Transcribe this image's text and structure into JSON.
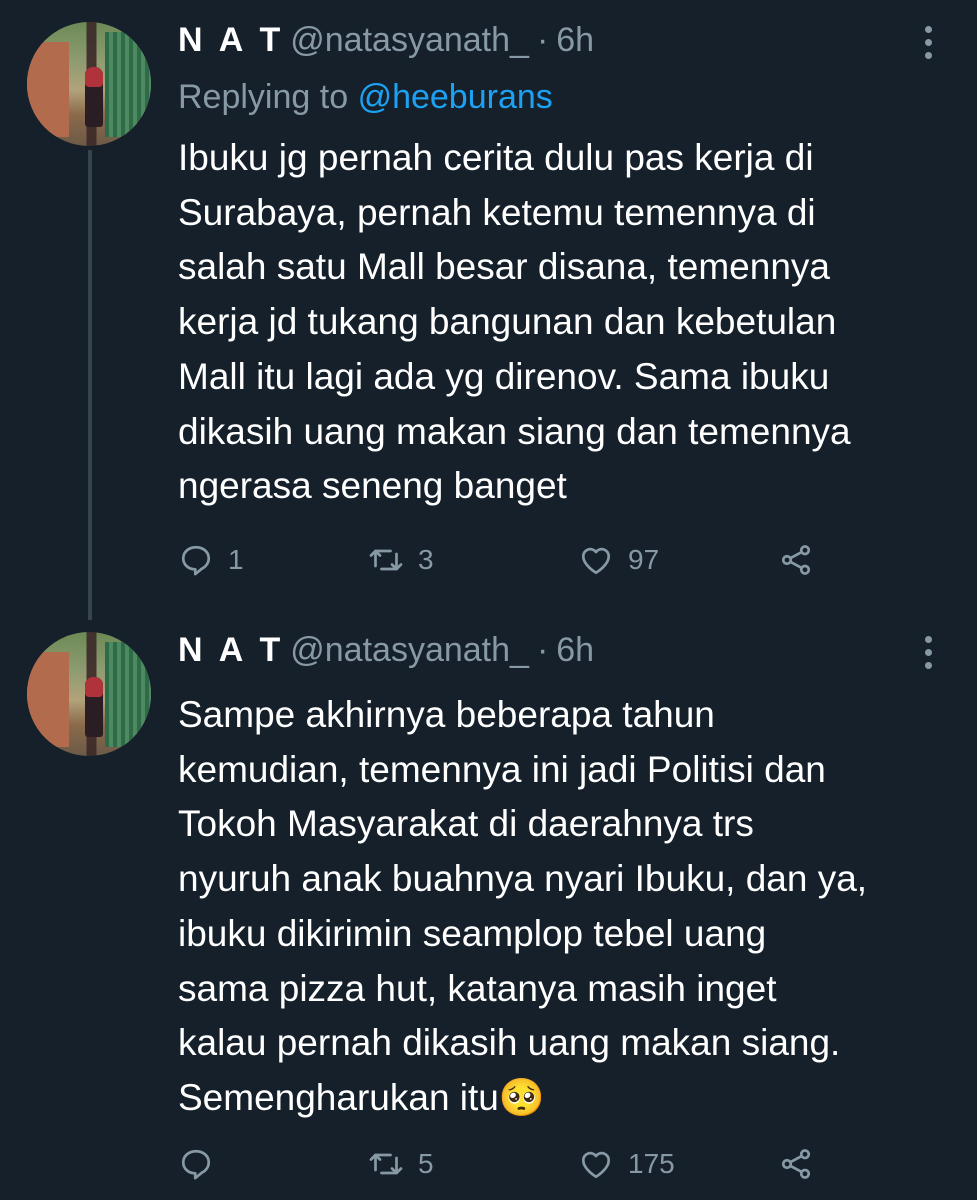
{
  "tweets": [
    {
      "display_name": "N A T",
      "handle": "@natasyanath_",
      "dot": "·",
      "time": "6h",
      "replying_prefix": "Replying to",
      "replying_to": "@heeburans",
      "lines": [
        "Ibuku jg pernah cerita dulu pas kerja di",
        "Surabaya, pernah ketemu temennya di",
        "salah satu Mall besar disana, temennya",
        "kerja jd tukang bangunan dan kebetulan",
        "Mall itu lagi ada yg direnov. Sama ibuku",
        "dikasih uang makan siang dan temennya",
        "ngerasa seneng banget"
      ],
      "replies": "1",
      "retweets": "3",
      "likes": "97"
    },
    {
      "display_name": "N A T",
      "handle": "@natasyanath_",
      "dot": "·",
      "time": "6h",
      "lines": [
        "Sampe akhirnya beberapa tahun",
        "kemudian, temennya ini jadi Politisi dan",
        "Tokoh Masyarakat di daerahnya trs",
        "nyuruh anak buahnya nyari Ibuku, dan ya,",
        "ibuku dikirimin seamplop tebel uang",
        "sama pizza hut, katanya masih inget",
        "kalau pernah dikasih uang makan siang.",
        "Semengharukan itu🥺"
      ],
      "replies": "",
      "retweets": "5",
      "likes": "175"
    }
  ],
  "colors": {
    "background": "#15202b",
    "secondary_text": "#8899a6",
    "link": "#1da1f2",
    "thread_line": "#38444d"
  },
  "icons": [
    "reply-icon",
    "retweet-icon",
    "like-icon",
    "share-icon",
    "more-options-icon"
  ]
}
